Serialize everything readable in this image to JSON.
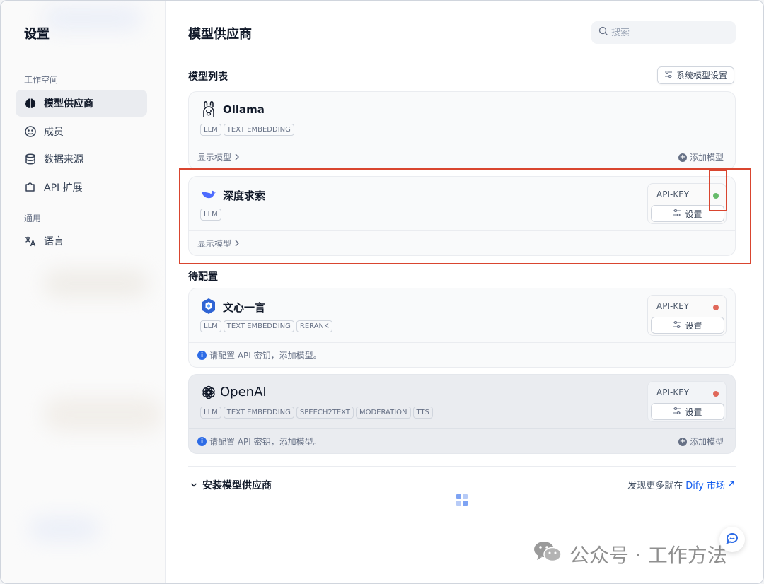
{
  "sidebar": {
    "title": "设置",
    "groups": [
      {
        "label": "工作空间"
      },
      {
        "label": "通用"
      }
    ],
    "items": [
      {
        "label": "模型供应商",
        "icon": "brain-icon",
        "active": true
      },
      {
        "label": "成员",
        "icon": "members-icon"
      },
      {
        "label": "数据来源",
        "icon": "database-icon"
      },
      {
        "label": "API 扩展",
        "icon": "puzzle-icon"
      },
      {
        "label": "语言",
        "icon": "translate-icon"
      }
    ]
  },
  "main": {
    "title": "模型供应商",
    "search": {
      "placeholder": "搜索",
      "value": ""
    },
    "model_list_label": "模型列表",
    "system_model_settings": "系统模型设置",
    "pending_label": "待配置",
    "install_label": "安装模型供应商",
    "market_text": "发现更多就在",
    "market_link": "Dify 市场"
  },
  "providers": [
    {
      "name": "Ollama",
      "icon": "llama-icon",
      "tags": [
        "LLM",
        "TEXT EMBEDDING"
      ],
      "footer_left": "显示模型",
      "footer_right": "添加模型"
    },
    {
      "name": "深度求索",
      "icon": "whale-icon",
      "tags": [
        "LLM"
      ],
      "footer_left": "显示模型",
      "api_key_label": "API-KEY",
      "status_color": "#66bb6a",
      "setting_label": "设置"
    },
    {
      "name": "文心一言",
      "icon": "wenxin-icon",
      "tags": [
        "LLM",
        "TEXT EMBEDDING",
        "RERANK"
      ],
      "footer_left": "请配置 API 密钥，添加模型。",
      "api_key_label": "API-KEY",
      "status_color": "#e0685a",
      "setting_label": "设置"
    },
    {
      "name": "OpenAI",
      "icon": "openai-icon",
      "tags": [
        "LLM",
        "TEXT EMBEDDING",
        "SPEECH2TEXT",
        "MODERATION",
        "TTS"
      ],
      "footer_left": "请配置 API 密钥，添加模型。",
      "footer_right": "添加模型",
      "api_key_label": "API-KEY",
      "status_color": "#e0685a",
      "setting_label": "设置"
    }
  ],
  "watermark": "公众号 · 工作方法",
  "colors": {
    "highlight": "#d9452f",
    "link": "#155eef",
    "info": "#2e6ce6"
  }
}
